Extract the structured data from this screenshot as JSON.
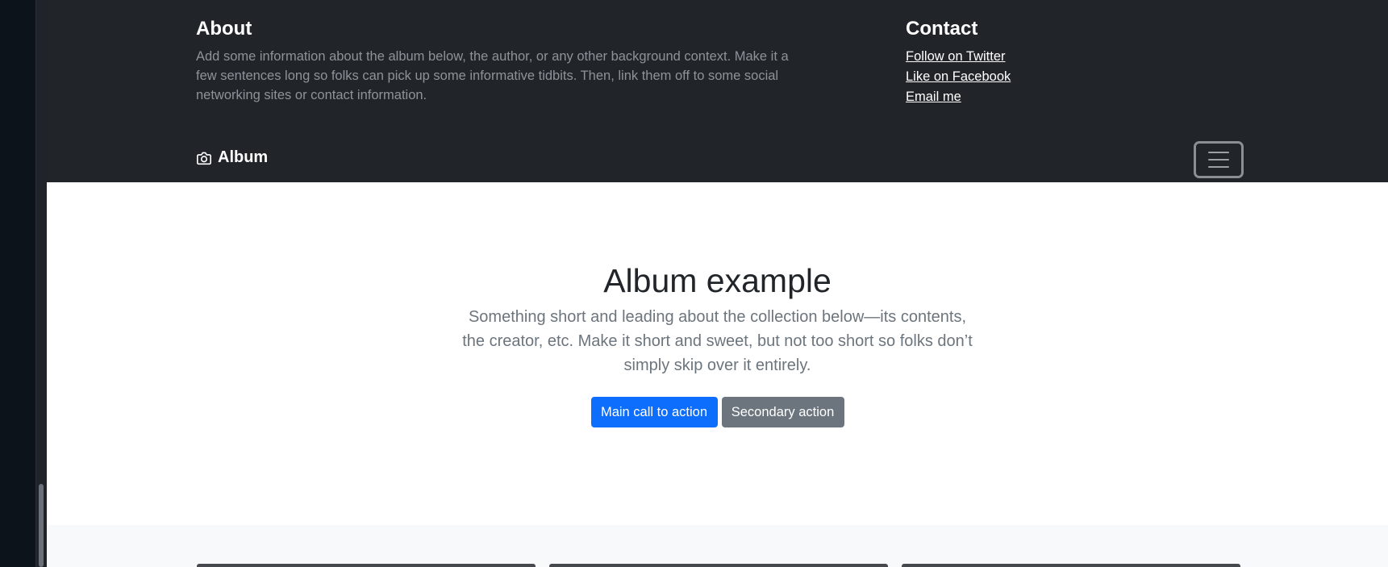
{
  "about": {
    "heading": "About",
    "text": "Add some information about the album below, the author, or any other background context. Make it a few sentences long so folks can pick up some informative tidbits. Then, link them off to some social networking sites or contact information."
  },
  "contact": {
    "heading": "Contact",
    "links": [
      "Follow on Twitter",
      "Like on Facebook",
      "Email me"
    ]
  },
  "navbar": {
    "brand": "Album",
    "brand_icon": "camera-icon",
    "toggler_icon": "hamburger-menu-icon"
  },
  "hero": {
    "title": "Album example",
    "lead": "Something short and leading about the collection below—its contents, the creator, etc. Make it short and sweet, but not too short so folks don’t simply skip over it entirely.",
    "primary_button": "Main call to action",
    "secondary_button": "Secondary action"
  },
  "colors": {
    "header_bg": "#212529",
    "primary": "#0d6efd",
    "secondary": "#6c757d",
    "album_bg": "#f8f9fa"
  }
}
